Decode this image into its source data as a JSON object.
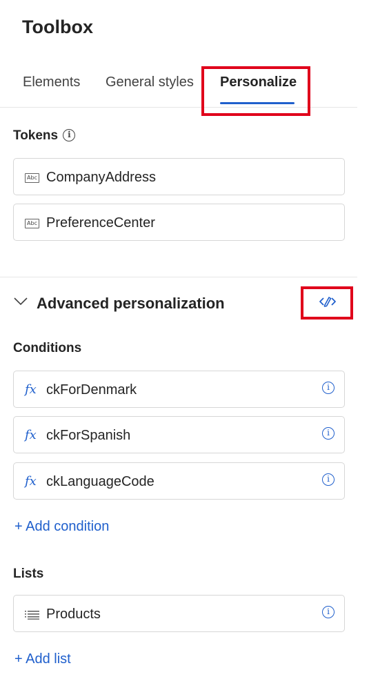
{
  "header": {
    "title": "Toolbox"
  },
  "tabs": [
    {
      "label": "Elements"
    },
    {
      "label": "General styles"
    },
    {
      "label": "Personalize"
    }
  ],
  "tokens": {
    "title": "Tokens",
    "info_glyph": "i",
    "items": [
      {
        "label": "CompanyAddress",
        "icon": "abc-text-icon",
        "icon_text": "Abc"
      },
      {
        "label": "PreferenceCenter",
        "icon": "abc-text-icon",
        "icon_text": "Abc"
      }
    ]
  },
  "advanced": {
    "title": "Advanced personalization",
    "conditions": {
      "title": "Conditions",
      "fx_glyph": "fx",
      "items": [
        {
          "label": "ckForDenmark"
        },
        {
          "label": "ckForSpanish"
        },
        {
          "label": "ckLanguageCode"
        }
      ],
      "add_label": "+ Add condition"
    },
    "lists": {
      "title": "Lists",
      "items": [
        {
          "label": "Products"
        }
      ],
      "add_label": "+ Add list"
    }
  },
  "colors": {
    "accent": "#1f5fcc",
    "highlight": "#e0001b"
  }
}
